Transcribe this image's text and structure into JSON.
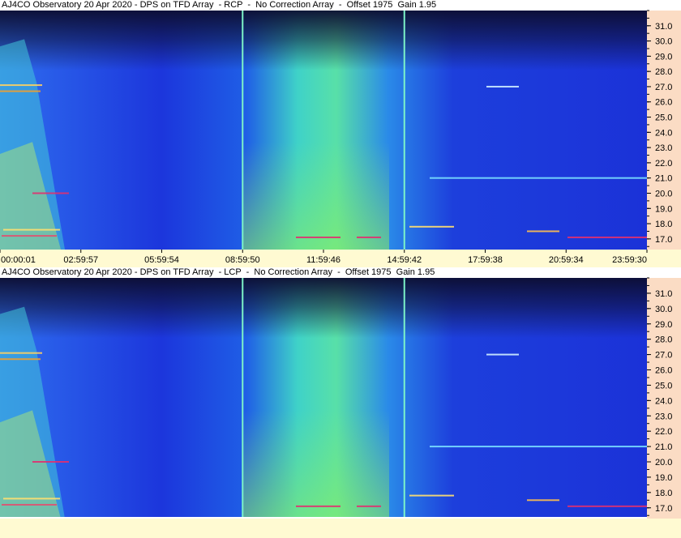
{
  "chart_data": [
    {
      "type": "heatmap",
      "title": "AJ4CO Observatory 20 Apr 2020 - DPS on TFD Array  - RCP  -  No Correction Array  -  Offset 1975  Gain 1.95",
      "xlabel": "",
      "ylabel": "",
      "x_ticks": [
        "00:00:01",
        "02:59:57",
        "05:59:54",
        "08:59:50",
        "11:59:46",
        "14:59:42",
        "17:59:38",
        "20:59:34",
        "23:59:30"
      ],
      "y_ticks": [
        "17.0",
        "18.0",
        "19.0",
        "20.0",
        "21.0",
        "22.0",
        "23.0",
        "24.0",
        "25.0",
        "26.0",
        "27.0",
        "28.0",
        "29.0",
        "30.0",
        "31.0"
      ],
      "xlim": [
        "00:00:01",
        "23:59:30"
      ],
      "ylim": [
        16.3,
        32.0
      ],
      "markers_time": [
        "08:59:50",
        "14:59:42"
      ]
    },
    {
      "type": "heatmap",
      "title": "AJ4CO Observatory 20 Apr 2020 - DPS on TFD Array  - LCP  -  No Correction Array  -  Offset 1975  Gain 1.95",
      "xlabel": "",
      "ylabel": "",
      "x_ticks": [],
      "y_ticks": [
        "17.0",
        "18.0",
        "19.0",
        "20.0",
        "21.0",
        "22.0",
        "23.0",
        "24.0",
        "25.0",
        "26.0",
        "27.0",
        "28.0",
        "29.0",
        "30.0",
        "31.0"
      ],
      "xlim": [
        "00:00:01",
        "23:59:30"
      ],
      "ylim": [
        16.3,
        32.0
      ],
      "markers_time": [
        "08:59:50",
        "14:59:42"
      ]
    }
  ],
  "colors": {
    "low": "#1a2bd8",
    "mid": "#1fb0e0",
    "high": "#9fef4a",
    "peak": "#e03070",
    "marker": "#7df3c8",
    "axis_bg": "#fbdcc4",
    "xaxis_bg": "#fffad2"
  }
}
